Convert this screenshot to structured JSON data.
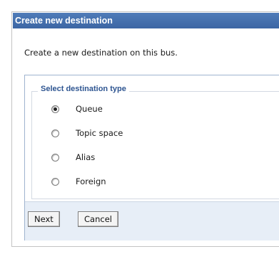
{
  "window": {
    "title": "Create new destination"
  },
  "intro_text": "Create a new destination on this bus.",
  "destination_type": {
    "legend": "Select destination type",
    "selected": "Queue",
    "options": [
      {
        "label": "Queue",
        "checked": true
      },
      {
        "label": "Topic space",
        "checked": false
      },
      {
        "label": "Alias",
        "checked": false
      },
      {
        "label": "Foreign",
        "checked": false
      }
    ]
  },
  "buttons": {
    "next": "Next",
    "cancel": "Cancel"
  },
  "colors": {
    "titlebar": "#3c66a4",
    "legend_text": "#2e5591",
    "button_bar": "#e7eef7"
  }
}
